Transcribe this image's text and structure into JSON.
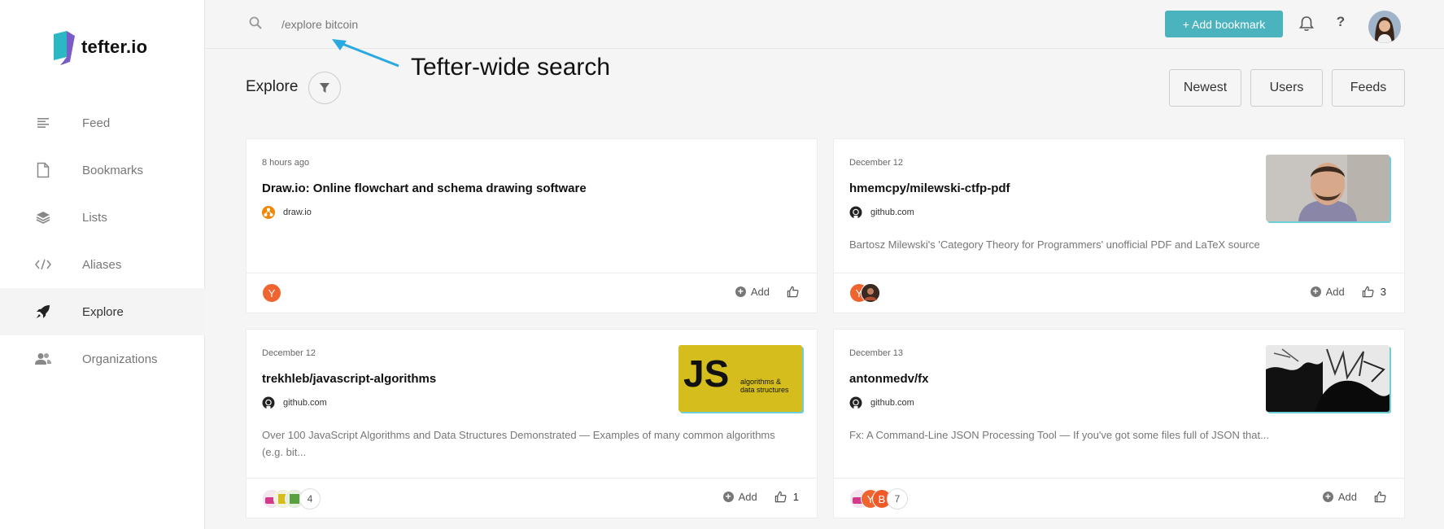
{
  "brand": {
    "name": "tefter.io"
  },
  "nav": {
    "items": [
      {
        "label": "Feed",
        "icon": "feed-icon"
      },
      {
        "label": "Bookmarks",
        "icon": "document-icon"
      },
      {
        "label": "Lists",
        "icon": "layers-icon"
      },
      {
        "label": "Aliases",
        "icon": "code-icon"
      },
      {
        "label": "Explore",
        "icon": "rocket-icon",
        "active": true
      },
      {
        "label": "Organizations",
        "icon": "users-icon"
      }
    ]
  },
  "topbar": {
    "search_value": "/explore bitcoin",
    "add_bookmark_label": "+ Add bookmark",
    "help_label": "?"
  },
  "annotation": {
    "text": "Tefter-wide search"
  },
  "explore": {
    "title": "Explore",
    "buttons": {
      "newest": "Newest",
      "users": "Users",
      "feeds": "Feeds"
    }
  },
  "cards": [
    {
      "date": "8 hours ago",
      "title": "Draw.io: Online flowchart and schema drawing software",
      "source": "draw.io",
      "description": "",
      "actions": {
        "add": "Add",
        "likes": ""
      }
    },
    {
      "date": "December 12",
      "title": "hmemcpy/milewski-ctfp-pdf",
      "source": "github.com",
      "description": "Bartosz Milewski's 'Category Theory for Programmers' unofficial PDF and LaTeX source",
      "actions": {
        "add": "Add",
        "likes": "3"
      }
    },
    {
      "date": "December 12",
      "title": "trekhleb/javascript-algorithms",
      "source": "github.com",
      "description": "Over 100 JavaScript Algorithms and Data Structures Demonstrated — Examples of many common algorithms (e.g. bit...",
      "thumb": {
        "big": "JS",
        "small1": "algorithms &",
        "small2": "data structures"
      },
      "extra_count": "4",
      "actions": {
        "add": "Add",
        "likes": "1"
      }
    },
    {
      "date": "December 13",
      "title": "antonmedv/fx",
      "source": "github.com",
      "description": "Fx: A Command-Line JSON Processing Tool — If you've got some files full of JSON that...",
      "extra_count": "7",
      "actions": {
        "add": "Add",
        "likes": ""
      }
    }
  ],
  "colors": {
    "accent": "#4ab3be",
    "hn_orange": "#f0652f",
    "annotation_arrow": "#29a9e0",
    "js_yellow": "#d4bd1c"
  }
}
